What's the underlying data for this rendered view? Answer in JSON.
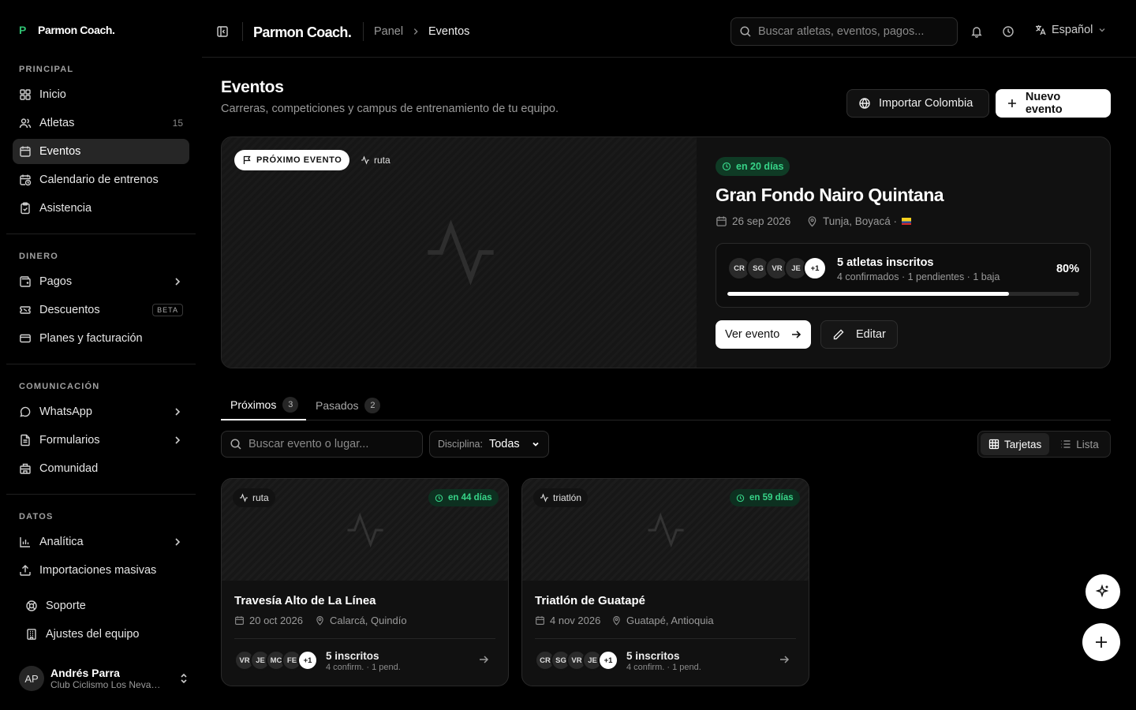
{
  "app": {
    "brand_mark": "P",
    "brand_name": "Parmon Coach."
  },
  "sidebar": {
    "sections": {
      "principal": "PRINCIPAL",
      "dinero": "DINERO",
      "comunicacion": "COMUNICACIÓN",
      "datos": "DATOS"
    },
    "items": {
      "inicio": {
        "label": "Inicio"
      },
      "atletas": {
        "label": "Atletas",
        "count": "15"
      },
      "eventos": {
        "label": "Eventos"
      },
      "calendario": {
        "label": "Calendario de entrenos"
      },
      "asistencia": {
        "label": "Asistencia"
      },
      "pagos": {
        "label": "Pagos"
      },
      "descuentos": {
        "label": "Descuentos",
        "badge": "BETA"
      },
      "planes": {
        "label": "Planes y facturación"
      },
      "whatsapp": {
        "label": "WhatsApp"
      },
      "formularios": {
        "label": "Formularios"
      },
      "comunidad": {
        "label": "Comunidad"
      },
      "analitica": {
        "label": "Analítica"
      },
      "importaciones": {
        "label": "Importaciones masivas"
      },
      "soporte": {
        "label": "Soporte"
      },
      "ajustes": {
        "label": "Ajustes del equipo"
      }
    },
    "user": {
      "initials": "AP",
      "name": "Andrés Parra",
      "club": "Club Ciclismo Los Nevados"
    }
  },
  "topbar": {
    "brand": "Parmon Coach.",
    "breadcrumb": [
      "Panel",
      "Eventos"
    ],
    "search_placeholder": "Buscar atletas, eventos, pagos...",
    "language": "Español"
  },
  "page": {
    "title": "Eventos",
    "subtitle": "Carreras, competiciones y campus de entrenamiento de tu equipo.",
    "import_button": "Importar Colombia",
    "new_button": "Nuevo evento"
  },
  "featured": {
    "badge": "PRÓXIMO EVENTO",
    "discipline": "ruta",
    "countdown": "en 20 días",
    "title": "Gran Fondo Nairo Quintana",
    "date": "26 sep 2026",
    "location": "Tunja, Boyacá ·",
    "avatars": [
      "CR",
      "SG",
      "VR",
      "JE",
      "+1"
    ],
    "athletes": "5 atletas inscritos",
    "breakdown": "4 confirmados · 1 pendientes · 1 baja",
    "percent": "80%",
    "progress": 0.8,
    "view_button": "Ver evento",
    "edit_button": "Editar"
  },
  "tabs": [
    {
      "label": "Próximos",
      "count": "3"
    },
    {
      "label": "Pasados",
      "count": "2"
    }
  ],
  "filters": {
    "search_placeholder": "Buscar evento o lugar...",
    "discipline_label": "Disciplina:",
    "discipline_value": "Todas",
    "view_cards": "Tarjetas",
    "view_list": "Lista"
  },
  "cards": [
    {
      "discipline": "ruta",
      "countdown": "en 44 días",
      "title": "Travesía Alto de La Línea",
      "date": "20 oct 2026",
      "location": "Calarcá, Quindío",
      "avatars": [
        "VR",
        "JE",
        "MC",
        "FE",
        "+1"
      ],
      "inscritos": "5 inscritos",
      "sub": "4 confirm. · 1 pend."
    },
    {
      "discipline": "triatlón",
      "countdown": "en 59 días",
      "title": "Triatlón de Guatapé",
      "date": "4 nov 2026",
      "location": "Guatapé, Antioquia",
      "avatars": [
        "CR",
        "SG",
        "VR",
        "JE",
        "+1"
      ],
      "inscritos": "5 inscritos",
      "sub": "4 confirm. · 1 pend."
    }
  ],
  "colors": {
    "accent_green": "#37d488",
    "background": "#000000",
    "surface": "#111111"
  }
}
